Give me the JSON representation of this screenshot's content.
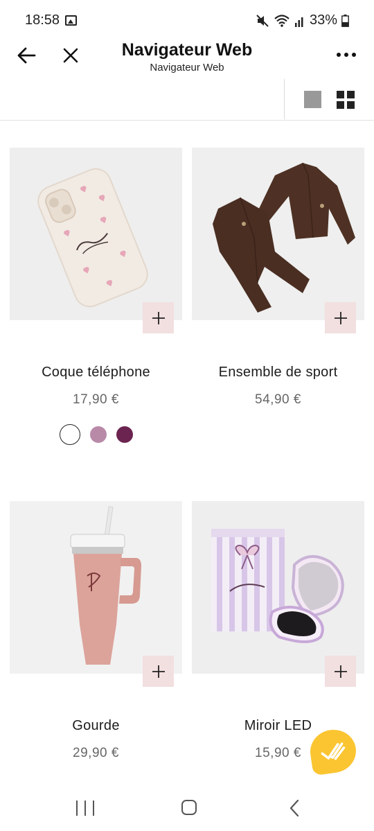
{
  "status_bar": {
    "time": "18:58",
    "battery": "33%",
    "icons": [
      "gallery-icon",
      "mute-icon",
      "wifi-icon",
      "signal-icon",
      "battery-icon"
    ]
  },
  "header": {
    "title": "Navigateur Web",
    "subtitle": "Navigateur Web",
    "icons": [
      "back-arrow-icon",
      "close-icon",
      "more-options-icon"
    ]
  },
  "view_toggle": {
    "options": [
      "single-column-view-icon",
      "grid-view-icon"
    ],
    "selected": "grid"
  },
  "products": [
    {
      "name": "Coque téléphone",
      "price": "17,90 €",
      "image": "phone-case",
      "swatches": [
        {
          "color": "#ffffff",
          "selected": true
        },
        {
          "color": "#b98aa8",
          "selected": false
        },
        {
          "color": "#6b2450",
          "selected": false
        }
      ]
    },
    {
      "name": "Ensemble de sport",
      "price": "54,90 €",
      "image": "sport-set"
    },
    {
      "name": "Gourde",
      "price": "29,90 €",
      "image": "tumbler"
    },
    {
      "name": "Miroir LED",
      "price": "15,90 €",
      "image": "led-mirror"
    }
  ],
  "colors": {
    "add_button_bg": "#f2dfe0",
    "fab_bg": "#fbc531",
    "price_text": "#666666"
  },
  "nav_bar": {
    "icons": [
      "recent-apps-icon",
      "home-icon",
      "nav-back-icon"
    ]
  }
}
